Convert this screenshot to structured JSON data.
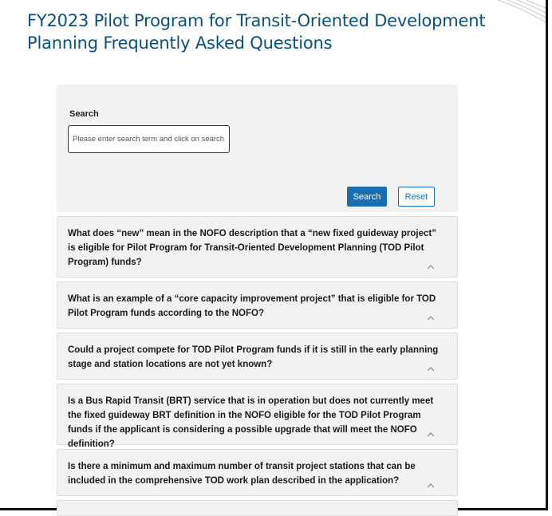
{
  "page": {
    "title": "FY2023 Pilot Program for Transit-Oriented Development Planning Frequently Asked Questions"
  },
  "search": {
    "label": "Search",
    "placeholder": "Please enter search term and click on search t",
    "search_button": "Search",
    "reset_button": "Reset"
  },
  "faq": {
    "items": [
      {
        "question": "What does “new” mean in the NOFO description that a “new fixed guideway project” is eligible for Pilot Program for Transit-Oriented Development Planning (TOD Pilot Program) funds?"
      },
      {
        "question": "What is an example of a “core capacity improvement project” that is eligible for TOD Pilot Program funds according to the NOFO?"
      },
      {
        "question": "Could a project compete for TOD Pilot Program funds if it is still in the early planning stage and station locations are not yet known?"
      },
      {
        "question": "Is a Bus Rapid Transit (BRT) service that is in operation but does not currently meet the fixed guideway BRT definition in the NOFO eligible for the TOD Pilot Program funds if the applicant is considering a possible upgrade that will meet the NOFO definition?"
      },
      {
        "question": "Is there a minimum and maximum number of transit project stations that can be included in the comprehensive TOD work plan described in the application?"
      }
    ]
  },
  "colors": {
    "title": "#0b4f7c",
    "accent": "#1a6eb0",
    "panel_bg": "#f2f2f2"
  },
  "icons": {
    "accordion_toggle": "chevron-up-icon"
  }
}
